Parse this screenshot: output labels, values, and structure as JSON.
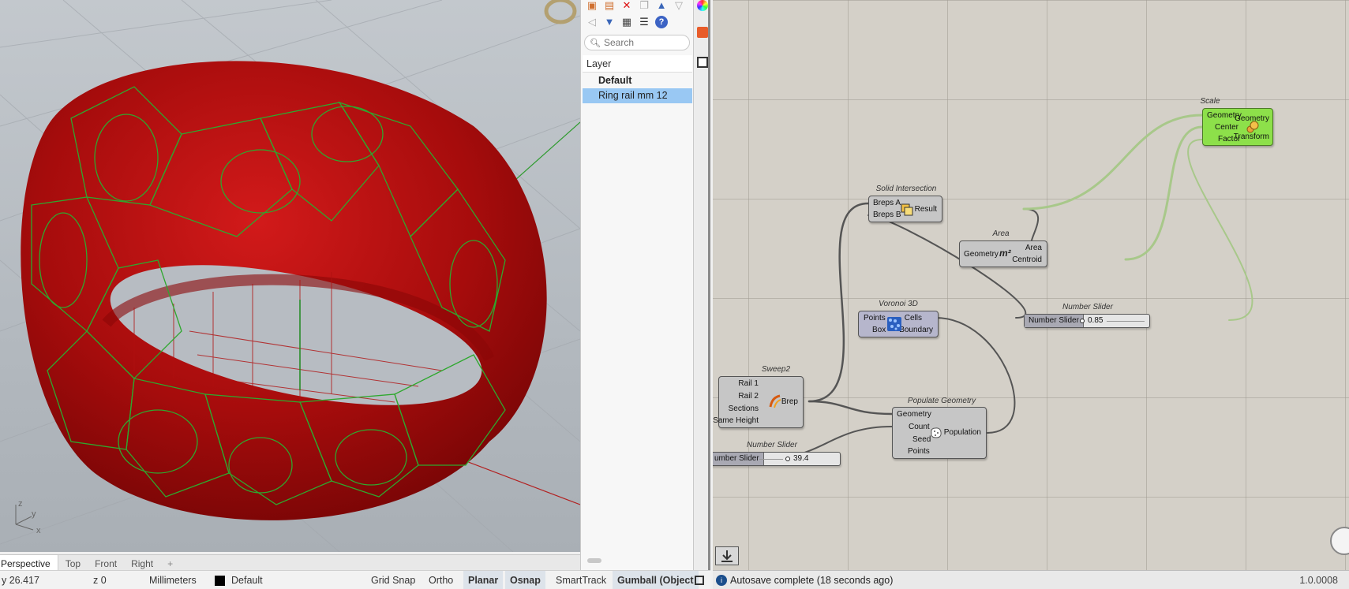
{
  "viewport": {
    "tabs": [
      "Perspective",
      "Top",
      "Front",
      "Right",
      "+"
    ],
    "axis": {
      "z": "z",
      "y": "y",
      "x": "x"
    }
  },
  "status": {
    "y": "y 26.417",
    "z": "z 0",
    "units": "Millimeters",
    "layer": "Default",
    "toggles": [
      "Grid Snap",
      "Ortho",
      "Planar",
      "Osnap",
      "SmartTrack",
      "Gumball (Object"
    ]
  },
  "layers": {
    "search_placeholder": "Search",
    "header": "Layer",
    "items": [
      {
        "name": "Default",
        "current": true,
        "selected": false
      },
      {
        "name": "Ring rail mm 12",
        "current": false,
        "selected": true
      }
    ],
    "toolbar_icons": [
      "new-layer-icon",
      "new-sublayer-icon",
      "delete-icon",
      "copy-icon",
      "move-up-icon",
      "move-down-icon",
      "back-icon",
      "filter-icon",
      "table-icon",
      "menu-icon",
      "help-icon"
    ]
  },
  "side_icons": [
    "color-wheel-icon",
    "layers-icon",
    "display-icon"
  ],
  "grasshopper": {
    "components": {
      "scale": {
        "title": "Scale",
        "inputs": [
          "Geometry",
          "Center",
          "Factor"
        ],
        "outputs": [
          "Geometry",
          "Transform"
        ]
      },
      "solid_intersection": {
        "title": "Solid Intersection",
        "inputs": [
          "Breps A",
          "Breps B"
        ],
        "outputs": [
          "Result"
        ]
      },
      "area": {
        "title": "Area",
        "inputs": [
          "Geometry"
        ],
        "outputs": [
          "Area",
          "Centroid"
        ]
      },
      "voronoi": {
        "title": "Voronoi 3D",
        "inputs": [
          "Points",
          "Box"
        ],
        "outputs": [
          "Cells",
          "Boundary"
        ]
      },
      "sweep2": {
        "title": "Sweep2",
        "inputs": [
          "Rail 1",
          "Rail 2",
          "Sections",
          "Same Height"
        ],
        "outputs": [
          "Brep"
        ]
      },
      "populate": {
        "title": "Populate Geometry",
        "inputs": [
          "Geometry",
          "Count",
          "Seed",
          "Points"
        ],
        "outputs": [
          "Population"
        ]
      }
    },
    "sliders": [
      {
        "title": "Number Slider",
        "label": "Number Slider",
        "value": "0.85"
      },
      {
        "title": "Number Slider",
        "label": "umber Slider",
        "value": "39.4"
      }
    ],
    "status_message": "Autosave complete (18 seconds ago)",
    "version": "1.0.0008"
  }
}
